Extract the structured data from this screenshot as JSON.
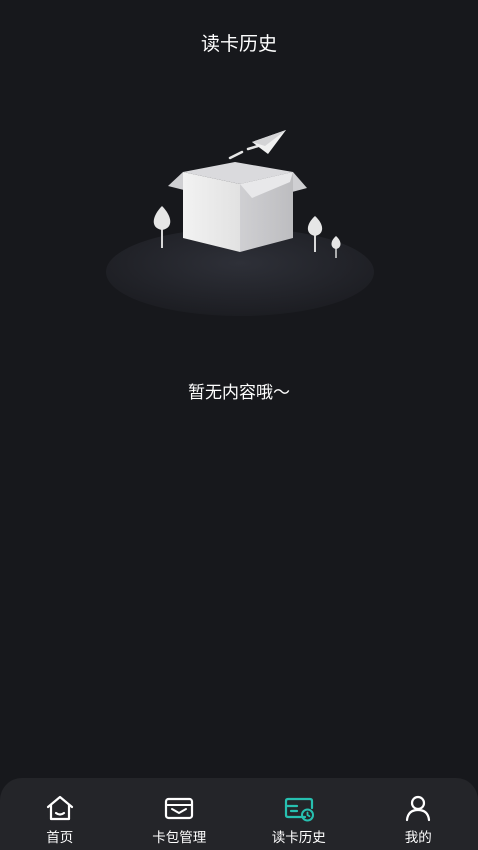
{
  "header": {
    "title": "读卡历史"
  },
  "empty_state": {
    "message": "暂无内容哦～"
  },
  "tabbar": {
    "accent": "#27c0b0",
    "items": [
      {
        "label": "首页",
        "icon": "home-icon",
        "active": false
      },
      {
        "label": "卡包管理",
        "icon": "card-wallet-icon",
        "active": false
      },
      {
        "label": "读卡历史",
        "icon": "card-history-icon",
        "active": true
      },
      {
        "label": "我的",
        "icon": "user-icon",
        "active": false
      }
    ]
  }
}
